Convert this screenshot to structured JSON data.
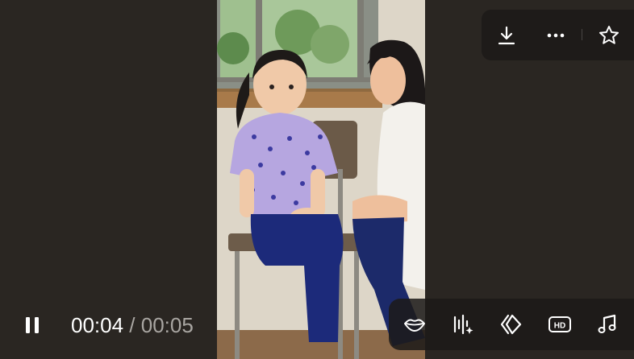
{
  "player": {
    "time": {
      "current": "00:04",
      "separator": " / ",
      "total": "00:05"
    },
    "play_state": "playing"
  },
  "top_toolbar": {
    "icons": [
      "download-icon",
      "more-options-icon",
      "star-icon"
    ]
  },
  "bottom_toolbar": {
    "icons": [
      "lips-icon",
      "ai-enhance-icon",
      "diamond-arrows-icon",
      "hd-icon",
      "music-note-icon"
    ]
  },
  "hd_badge_text": "HD",
  "colors": {
    "background": "#2a2622",
    "toolbar": "#1c1a18",
    "time_primary": "#ffffff",
    "time_secondary": "#a9a6a2"
  }
}
